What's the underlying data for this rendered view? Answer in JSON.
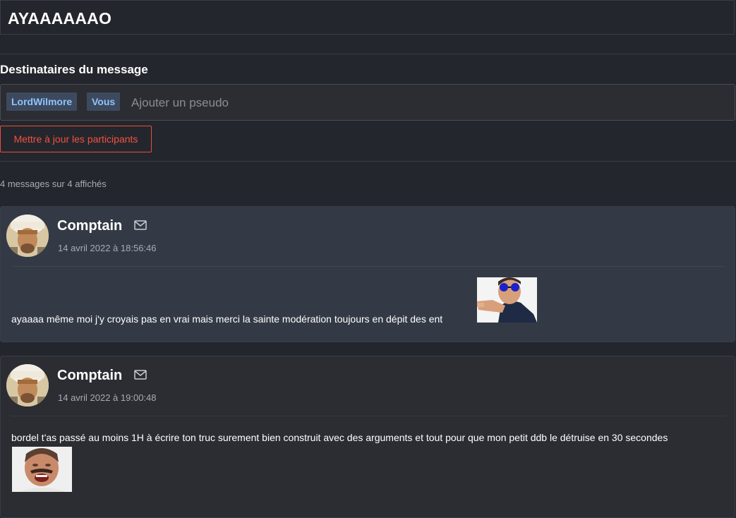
{
  "header": {
    "title": "AYAAAAAAO"
  },
  "recipients": {
    "title": "Destinataires du message",
    "chips": [
      "LordWilmore",
      "Vous"
    ],
    "placeholder": "Ajouter un pseudo",
    "update_label": "Mettre à jour les participants"
  },
  "count_label": "4 messages sur 4 affichés",
  "messages": [
    {
      "author": "Comptain",
      "date": "14 avril 2022 à 18:56:46",
      "text": "ayaaaa même moi j'y croyais pas en vrai mais merci la sainte modération toujours en dépit des ent"
    },
    {
      "author": "Comptain",
      "date": "14 avril 2022 à 19:00:48",
      "text": "bordel t'as passé au moins 1H à écrire ton truc surement bien construit avec des arguments et tout pour que mon petit ddb le détruise en 30 secondes"
    }
  ],
  "icons": {
    "mail": "envelope-icon",
    "avatar": "avatar-image",
    "sticker1": "sticker-pointing-man-sunglasses",
    "sticker2": "sticker-laughing-man"
  },
  "colors": {
    "background": "#24262d",
    "accent_red": "#f0533d",
    "chip_text": "#8ec4ff",
    "chip_bg": "#3d4a5e",
    "highlighted_message_bg": "#343a45"
  }
}
